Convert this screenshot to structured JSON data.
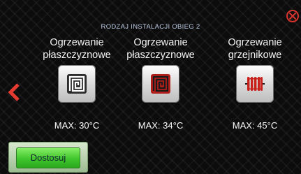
{
  "screen": {
    "title": "RODZAJ INSTALACJI OBIEG 2"
  },
  "controls": {
    "close_icon": "close-circle-icon",
    "back_icon": "chevron-left-icon",
    "accent_color": "#d6342c"
  },
  "options": [
    {
      "label_line1": "Ogrzewanie",
      "label_line2": "płaszczyznowe",
      "max": "MAX: 30°C",
      "icon": "floor-heating-spiral-icon",
      "selected": false
    },
    {
      "label_line1": "Ogrzewanie",
      "label_line2": "płaszczyznowe",
      "max": "MAX: 34°C",
      "icon": "floor-heating-spiral-icon",
      "selected": true
    },
    {
      "label_line1": "Ogrzewanie",
      "label_line2": "grzejnikowe",
      "max": "MAX: 45°C",
      "icon": "radiator-icon",
      "selected": false
    }
  ],
  "footer": {
    "adjust_label": "Dostosuj",
    "adjust_color": "#3fc62c"
  }
}
